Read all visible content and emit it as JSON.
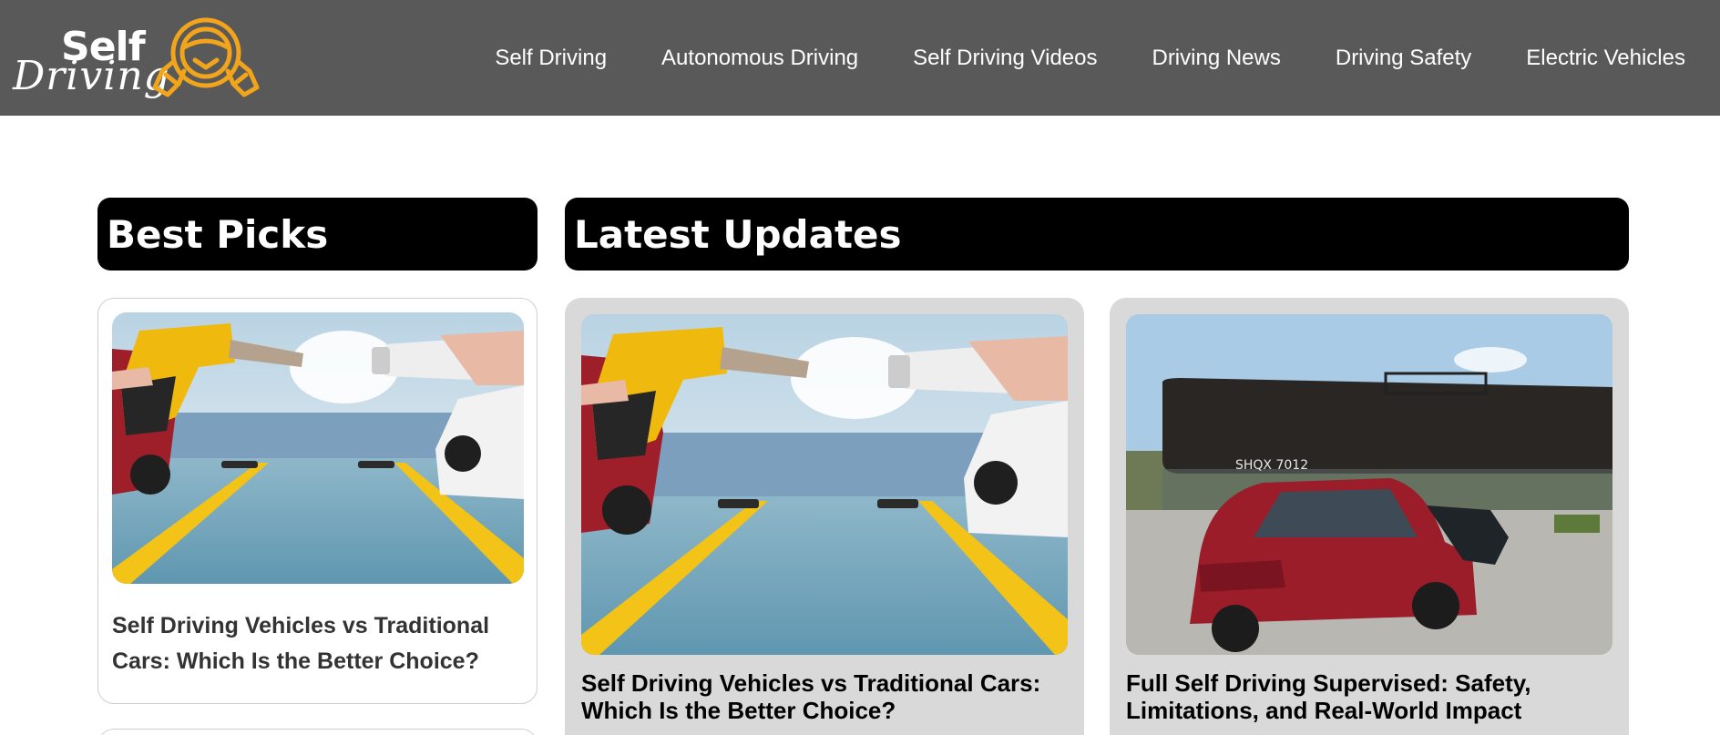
{
  "header": {
    "logo": {
      "line1": "Self",
      "line2": "Driving"
    },
    "nav": [
      {
        "label": "Self Driving"
      },
      {
        "label": "Autonomous Driving"
      },
      {
        "label": "Self Driving Videos"
      },
      {
        "label": "Driving News"
      },
      {
        "label": "Driving Safety"
      },
      {
        "label": "Electric Vehicles"
      }
    ]
  },
  "best_picks": {
    "heading": "Best Picks",
    "items": [
      {
        "title": "Self Driving Vehicles vs Traditional Cars: Which Is the Better Choice?",
        "image": "fuel-nozzle-vs-ev-charger-photo"
      }
    ]
  },
  "latest_updates": {
    "heading": "Latest Updates",
    "items": [
      {
        "title": "Self Driving Vehicles vs Traditional Cars: Which Is the Better Choice?",
        "image": "fuel-nozzle-vs-ev-charger-photo"
      },
      {
        "title": "Full Self Driving Supervised: Safety, Limitations, and Real-World Impact",
        "image": "red-tesla-near-train-photo"
      }
    ]
  },
  "colors": {
    "header_bg": "#595959",
    "logo_accent": "#f2a51a",
    "heading_bg": "#000000",
    "card_bg": "#d9d9d9"
  }
}
